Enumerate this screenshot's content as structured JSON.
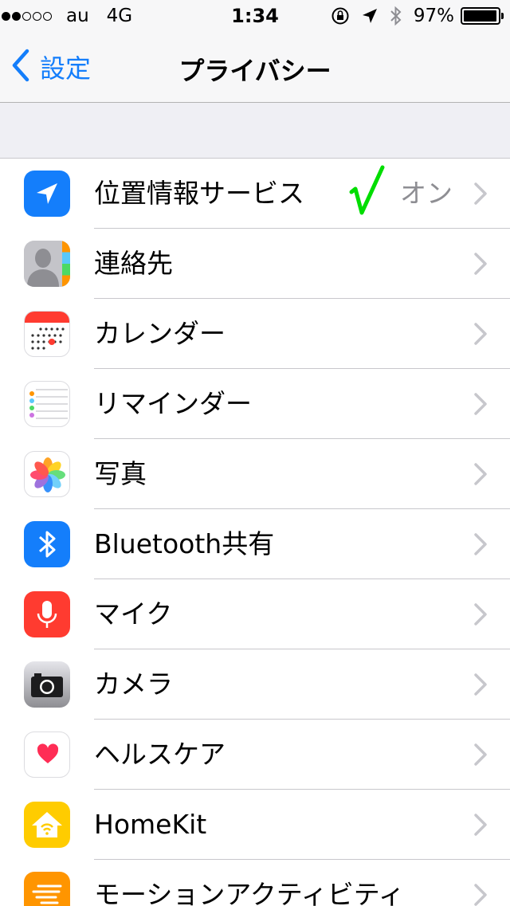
{
  "status_bar": {
    "signal_dots_filled": 2,
    "signal_dots_total": 5,
    "carrier": "au",
    "network": "4G",
    "time": "1:34",
    "battery_percent": "97%",
    "battery_level": 0.97,
    "icons": [
      "rotation-lock-icon",
      "location-arrow-icon",
      "bluetooth-icon"
    ]
  },
  "nav": {
    "back_label": "設定",
    "title": "プライバシー"
  },
  "annotation": {
    "check_color": "#00dd00"
  },
  "colors": {
    "accent": "#147efb",
    "separator": "#c8c7cc",
    "group_background": "#efeff4"
  },
  "rows": [
    {
      "label": "位置情報サービス",
      "value": "オン",
      "icon": "location-services-icon",
      "color": "#147efb"
    },
    {
      "label": "連絡先",
      "value": "",
      "icon": "contacts-icon",
      "color": "#9e9e9e"
    },
    {
      "label": "カレンダー",
      "value": "",
      "icon": "calendar-icon",
      "color": "#ff3b30"
    },
    {
      "label": "リマインダー",
      "value": "",
      "icon": "reminders-icon",
      "color": "#ffffff"
    },
    {
      "label": "写真",
      "value": "",
      "icon": "photos-icon",
      "color": "#ffffff"
    },
    {
      "label": "Bluetooth共有",
      "value": "",
      "icon": "bluetooth-sharing-icon",
      "color": "#147efb"
    },
    {
      "label": "マイク",
      "value": "",
      "icon": "microphone-icon",
      "color": "#ff3b30"
    },
    {
      "label": "カメラ",
      "value": "",
      "icon": "camera-icon",
      "color": "#8e8e93"
    },
    {
      "label": "ヘルスケア",
      "value": "",
      "icon": "health-icon",
      "color": "#ffffff"
    },
    {
      "label": "HomeKit",
      "value": "",
      "icon": "homekit-icon",
      "color": "#ffcc00"
    },
    {
      "label": "モーションアクティビティ",
      "value": "",
      "icon": "motion-activity-icon",
      "color": "#ff9500"
    }
  ]
}
